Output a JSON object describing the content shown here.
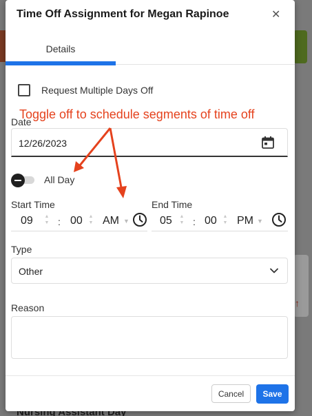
{
  "modal": {
    "title": "Time Off Assignment for Megan Rapinoe",
    "close_symbol": "✕",
    "tabs": [
      {
        "label": "Details",
        "active": true
      }
    ]
  },
  "form": {
    "multiple_days": {
      "label": "Request Multiple Days Off",
      "checked": false
    },
    "date": {
      "label": "Date",
      "value": "12/26/2023"
    },
    "all_day": {
      "label": "All Day",
      "on": false
    },
    "start_time": {
      "label": "Start Time",
      "hour": "09",
      "minute": "00",
      "period": "AM"
    },
    "end_time": {
      "label": "End Time",
      "hour": "05",
      "minute": "00",
      "period": "PM"
    },
    "type": {
      "label": "Type",
      "value": "Other"
    },
    "reason": {
      "label": "Reason",
      "value": ""
    },
    "time_separator": ":"
  },
  "footer": {
    "cancel_label": "Cancel",
    "save_label": "Save"
  },
  "annotation": {
    "text": "Toggle off to schedule segments of time off",
    "color": "#e5421d"
  },
  "background": {
    "bottom_text": "Nursing Assistant Day"
  },
  "colors": {
    "accent": "#1e73e8",
    "annotation": "#e5421d"
  },
  "icons": {
    "calendar": "calendar-icon",
    "clock": "clock-icon",
    "close": "close-icon",
    "chevron": "chevron-down-icon"
  }
}
